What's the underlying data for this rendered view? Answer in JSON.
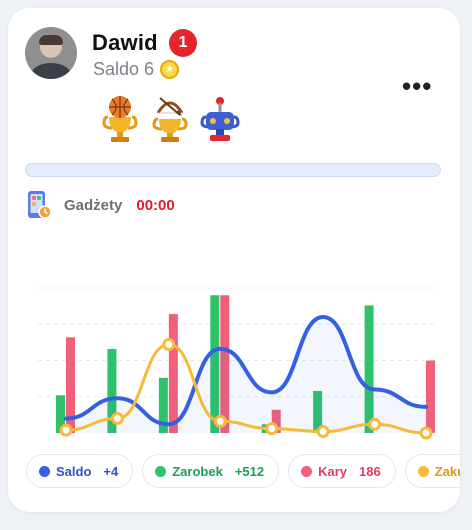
{
  "user": {
    "name": "Dawid",
    "notification_count": "1",
    "balance_label": "Saldo 6"
  },
  "category": {
    "label": "Gadżety",
    "time": "00:00"
  },
  "progress": {
    "fraction": 0.0
  },
  "chart_data": {
    "type": "bar",
    "points": 8,
    "series": [
      {
        "name": "Zarobek",
        "kind": "bar",
        "color": "#2ec26a",
        "values": [
          26,
          58,
          38,
          95,
          6,
          29,
          88,
          0
        ]
      },
      {
        "name": "Kary",
        "kind": "bar",
        "color": "#f0607a",
        "values": [
          66,
          0,
          82,
          95,
          16,
          0,
          0,
          50
        ]
      },
      {
        "name": "Saldo",
        "kind": "line",
        "color": "#3461e0",
        "values": [
          10,
          24,
          6,
          58,
          28,
          80,
          30,
          18
        ]
      },
      {
        "name": "Zakupy",
        "kind": "line-markers",
        "color": "#f6b93b",
        "values": [
          2,
          10,
          61,
          8,
          3,
          1,
          6,
          0
        ]
      }
    ],
    "ylim": [
      0,
      100
    ],
    "grid": true
  },
  "legend": [
    {
      "name": "Saldo",
      "value": "+4",
      "color": "#3461e0",
      "text_color": "#2a56c9"
    },
    {
      "name": "Zarobek",
      "value": "+512",
      "color": "#2ec26a",
      "text_color": "#1f9d55"
    },
    {
      "name": "Kary",
      "value": "186",
      "color": "#f0607a",
      "text_color": "#d9405e"
    },
    {
      "name": "Zakupy",
      "value": "",
      "color": "#f6b93b",
      "text_color": "#d49a1a"
    }
  ],
  "icons": {
    "trophies": [
      "basketball-trophy-icon",
      "archery-trophy-icon",
      "gaming-trophy-icon"
    ],
    "category": "gadget-phone-icon",
    "menu": "more-options-icon",
    "coin": "coin-icon"
  }
}
